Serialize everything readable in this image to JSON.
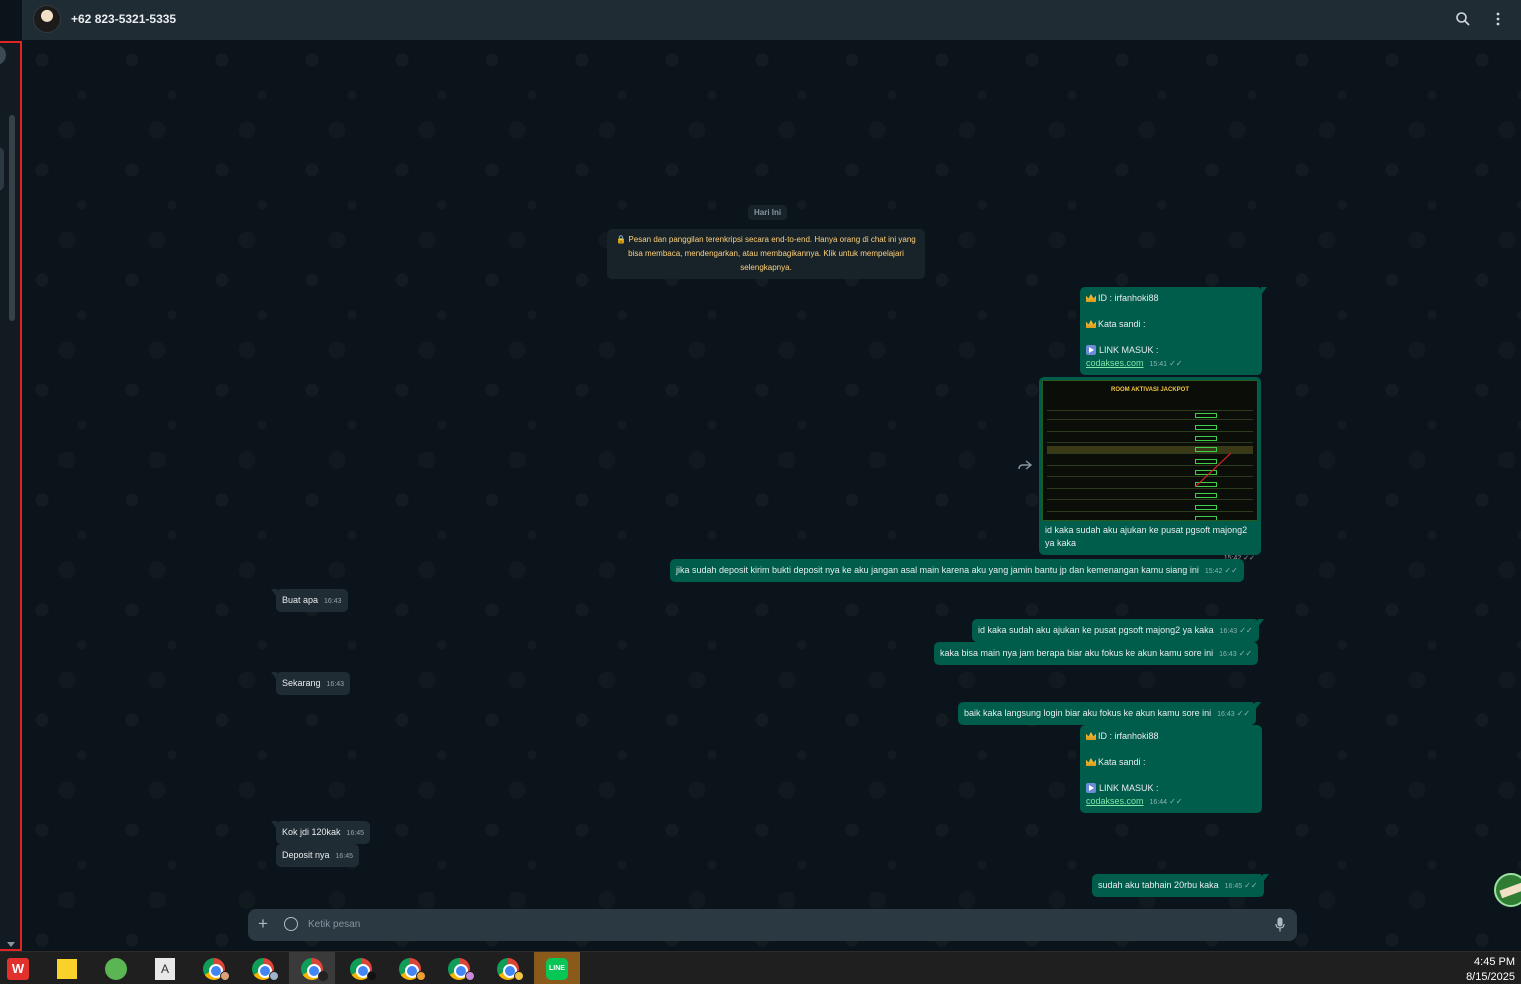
{
  "header": {
    "contact_name": "+62 823-5321-5335",
    "icons": [
      "search-icon",
      "menu-icon"
    ]
  },
  "chat": {
    "date_chip": "Hari Ini",
    "encryption_notice": "🔒 Pesan dan panggilan terenkripsi secara end-to-end. Hanya orang di chat ini yang bisa membaca, mendengarkan, atau membagikannya. Klik untuk mempelajari selengkapnya.",
    "messages": [
      {
        "dir": "out",
        "id_label": "ID :  irfanhoki88",
        "password_label": "Kata sandi :",
        "link_prefix": "LINK MASUK :",
        "link": "codakses.com",
        "time": "15:41"
      },
      {
        "dir": "out",
        "image_title": "ROOM AKTIVASI JACKPOT",
        "caption": "id kaka sudah aku ajukan ke pusat pgsoft majong2 ya kaka",
        "time": "15:42"
      },
      {
        "dir": "out",
        "text": "jika sudah deposit kirim bukti deposit nya ke aku jangan asal main karena aku yang jamin bantu jp dan kemenangan kamu siang ini",
        "time": "15:42"
      },
      {
        "dir": "in",
        "text": "Buat apa",
        "time": "16:43"
      },
      {
        "dir": "out",
        "text": "id kaka sudah aku ajukan ke pusat pgsoft majong2 ya kaka",
        "time": "16:43"
      },
      {
        "dir": "out",
        "text": "kaka bisa main nya jam berapa biar aku fokus ke akun kamu sore ini",
        "time": "16:43"
      },
      {
        "dir": "in",
        "text": "Sekarang",
        "time": "16:43"
      },
      {
        "dir": "out",
        "text": "baik kaka langsung login biar aku fokus ke akun kamu sore ini",
        "time": "16:43"
      },
      {
        "dir": "out",
        "id_label": "ID :  irfanhoki88",
        "password_label": "Kata sandi :",
        "link_prefix": "LINK MASUK :",
        "link": "codakses.com",
        "time": "16:44"
      },
      {
        "dir": "in",
        "text": "Kok jdi 120kak",
        "time": "16:45"
      },
      {
        "dir": "in",
        "text": "Deposit nya",
        "time": "16:45"
      },
      {
        "dir": "out",
        "text": "sudah aku tabhain 20rbu kaka",
        "time": "16:45"
      }
    ],
    "ticks": "✓✓"
  },
  "composer": {
    "placeholder": "Ketik pesan"
  },
  "taskbar": {
    "time": "4:45 PM",
    "date": "8/15/2025",
    "apps": [
      "wps-office-icon",
      "sticky-notes-icon",
      "messaging-icon",
      "text-editor-icon",
      "chrome-icon",
      "chrome-icon",
      "chrome-icon",
      "chrome-icon",
      "chrome-icon",
      "chrome-icon",
      "chrome-icon",
      "line-icon"
    ]
  },
  "colors": {
    "outgoing_bubble": "#005c4b",
    "incoming_bubble": "#202c33",
    "background": "#0b141a",
    "notice_text": "#ffd279"
  }
}
